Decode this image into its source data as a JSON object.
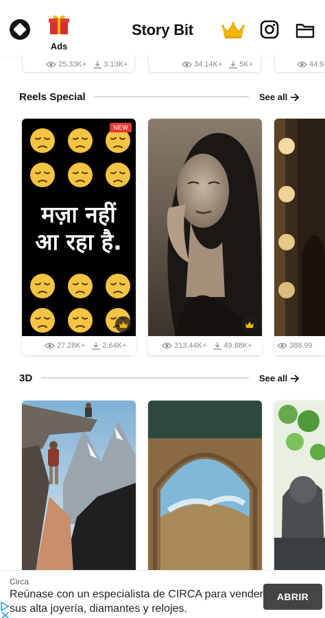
{
  "header": {
    "title": "Story Bit",
    "ads_label": "Ads",
    "icons": [
      "app-logo-icon",
      "gift-icon",
      "crown-icon",
      "instagram-icon",
      "folder-icon"
    ]
  },
  "top_row": {
    "items": [
      {
        "views": "25.33K+",
        "downloads": "3.13K+"
      },
      {
        "views": "34.14K+",
        "downloads": "5K+"
      },
      {
        "views": "44.9"
      }
    ]
  },
  "sections": [
    {
      "title": "Reels Special",
      "see_all": "See all",
      "cards": [
        {
          "badge": "NEW",
          "text_line1": "मज़ा नहीं",
          "text_line2": "आ रहा है.",
          "emoji": "😔",
          "premium": true,
          "views": "27.28K+",
          "downloads": "2.64K+"
        },
        {
          "premium": true,
          "views": "313.44K+",
          "downloads": "49.88K+"
        },
        {
          "views": "388.99"
        }
      ]
    },
    {
      "title": "3D",
      "see_all": "See all",
      "cards": [
        {},
        {},
        {}
      ]
    }
  ],
  "ad": {
    "brand": "Circa",
    "text": "Reúnase con un especialista de CIRCA para vender sus alta joyería, diamantes y relojes.",
    "button": "ABRIR"
  },
  "colors": {
    "accent_red": "#e53935",
    "crown_gold": "#f2b705",
    "gift_red": "#d32f2f",
    "stats_gray": "#8a8a8a"
  }
}
